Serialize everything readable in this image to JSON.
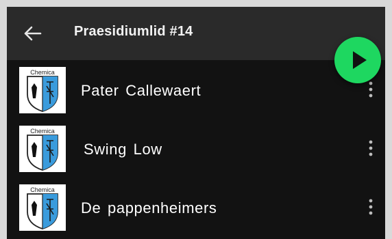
{
  "header": {
    "title": "Praesidiumlid #14",
    "back_icon": "arrow-left-icon"
  },
  "play_button": {
    "icon": "play-icon",
    "color": "#1ed760"
  },
  "tracks": [
    {
      "title": "Pater Callewaert",
      "cover_text": "Chemica"
    },
    {
      "title": "Swing Low",
      "cover_text": "Chemica"
    },
    {
      "title": "De pappenheimers",
      "cover_text": "Chemica"
    }
  ],
  "colors": {
    "background": "#121212",
    "header": "#2a2a2a",
    "text": "#ffffff",
    "accent": "#1ed760",
    "shield_blue": "#3a9bdc"
  }
}
